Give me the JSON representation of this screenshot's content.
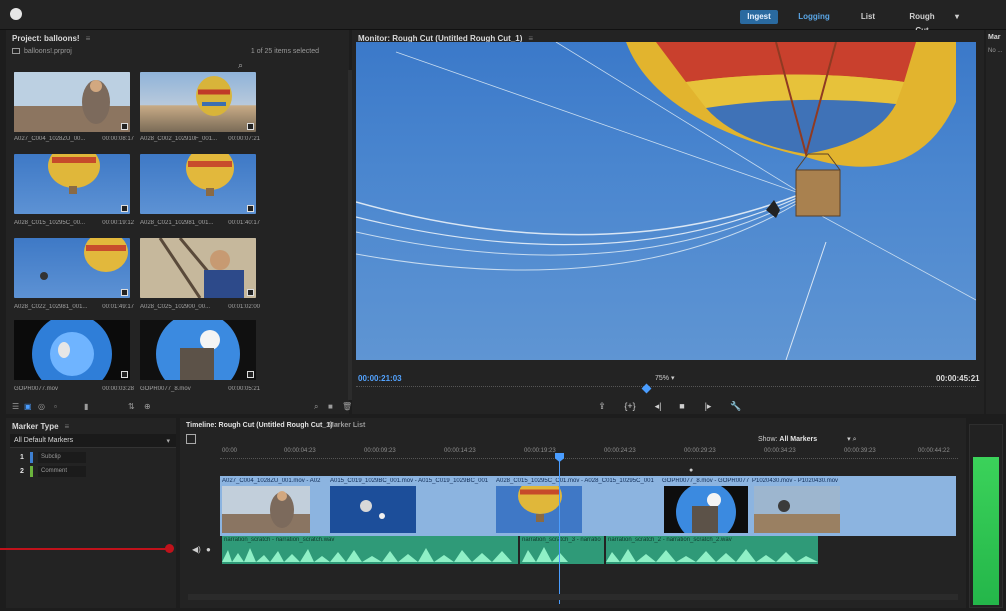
{
  "workspaces": [
    "Ingest",
    "Logging",
    "List",
    "Rough Cut"
  ],
  "project": {
    "title": "Project: balloons!",
    "file": "balloons!.prproj",
    "count": "1 of 25 items selected",
    "clips": [
      {
        "name": "A027_C004_1028ZU_00...",
        "dur": "00:00:08:17"
      },
      {
        "name": "A028_C002_102910F_001...",
        "dur": "00:00:07:21"
      },
      {
        "name": "A028_C015_10295C_00...",
        "dur": "00:00:19:12"
      },
      {
        "name": "A028_C021_102981_001...",
        "dur": "00:01:40:17"
      },
      {
        "name": "A028_C022_102981_001...",
        "dur": "00:01:49:17"
      },
      {
        "name": "A028_C025_102900_00...",
        "dur": "00:01:02:00"
      },
      {
        "name": "GOPR0077.mov",
        "dur": "00:00:03:28"
      },
      {
        "name": "GOPR0077_8.mov",
        "dur": "00:00:05:21"
      }
    ]
  },
  "monitor": {
    "title": "Monitor: Rough Cut (Untitled Rough Cut_1)",
    "current_tc": "00:00:21:03",
    "duration_tc": "00:00:45:21",
    "zoom": "75%"
  },
  "right_panel": {
    "title": "Mar",
    "sub": "No ..."
  },
  "markers": {
    "title": "Marker Type",
    "filter": "All Default Markers",
    "items": [
      {
        "num": "1",
        "label": "Subclip",
        "color": "#3e7fd0"
      },
      {
        "num": "2",
        "label": "Comment",
        "color": "#6bb33d"
      }
    ]
  },
  "timeline": {
    "tab_main": "Timeline: Rough Cut (Untitled Rough Cut_1)",
    "tab_markers": "Marker List",
    "show_label": "Show:",
    "show_value": "All Markers",
    "ticks": [
      "00:00",
      "00:00:04:23",
      "00:00:09:23",
      "00:00:14:23",
      "00:00:19:23",
      "00:00:24:23",
      "00:00:29:23",
      "00:00:34:23",
      "00:00:39:23",
      "00:00:44:22"
    ],
    "video_clips": [
      "A027_C004_1028ZU_001.mov - A02",
      "A015_C019_1029BC_001.mov - A015_C019_1029BC_001",
      "A028_C015_10295C_C01.mov - A028_C015_10295C_001",
      "GOPR0077_8.mov - GOPR0077",
      "P1020430.mov - P1020430.mov"
    ],
    "audio_clips": [
      "narration_scratch - narration_scratch.wav",
      "narration_scratch_3 - narratio",
      "narration_scratch_2 - narration_scratch_2.wav"
    ]
  },
  "colors": {
    "accent": "#2a6aa0",
    "playhead": "#4a9dff",
    "video_track": "#8cb4e0",
    "audio_track": "#2f9a78",
    "annotation": "#c0121b"
  }
}
